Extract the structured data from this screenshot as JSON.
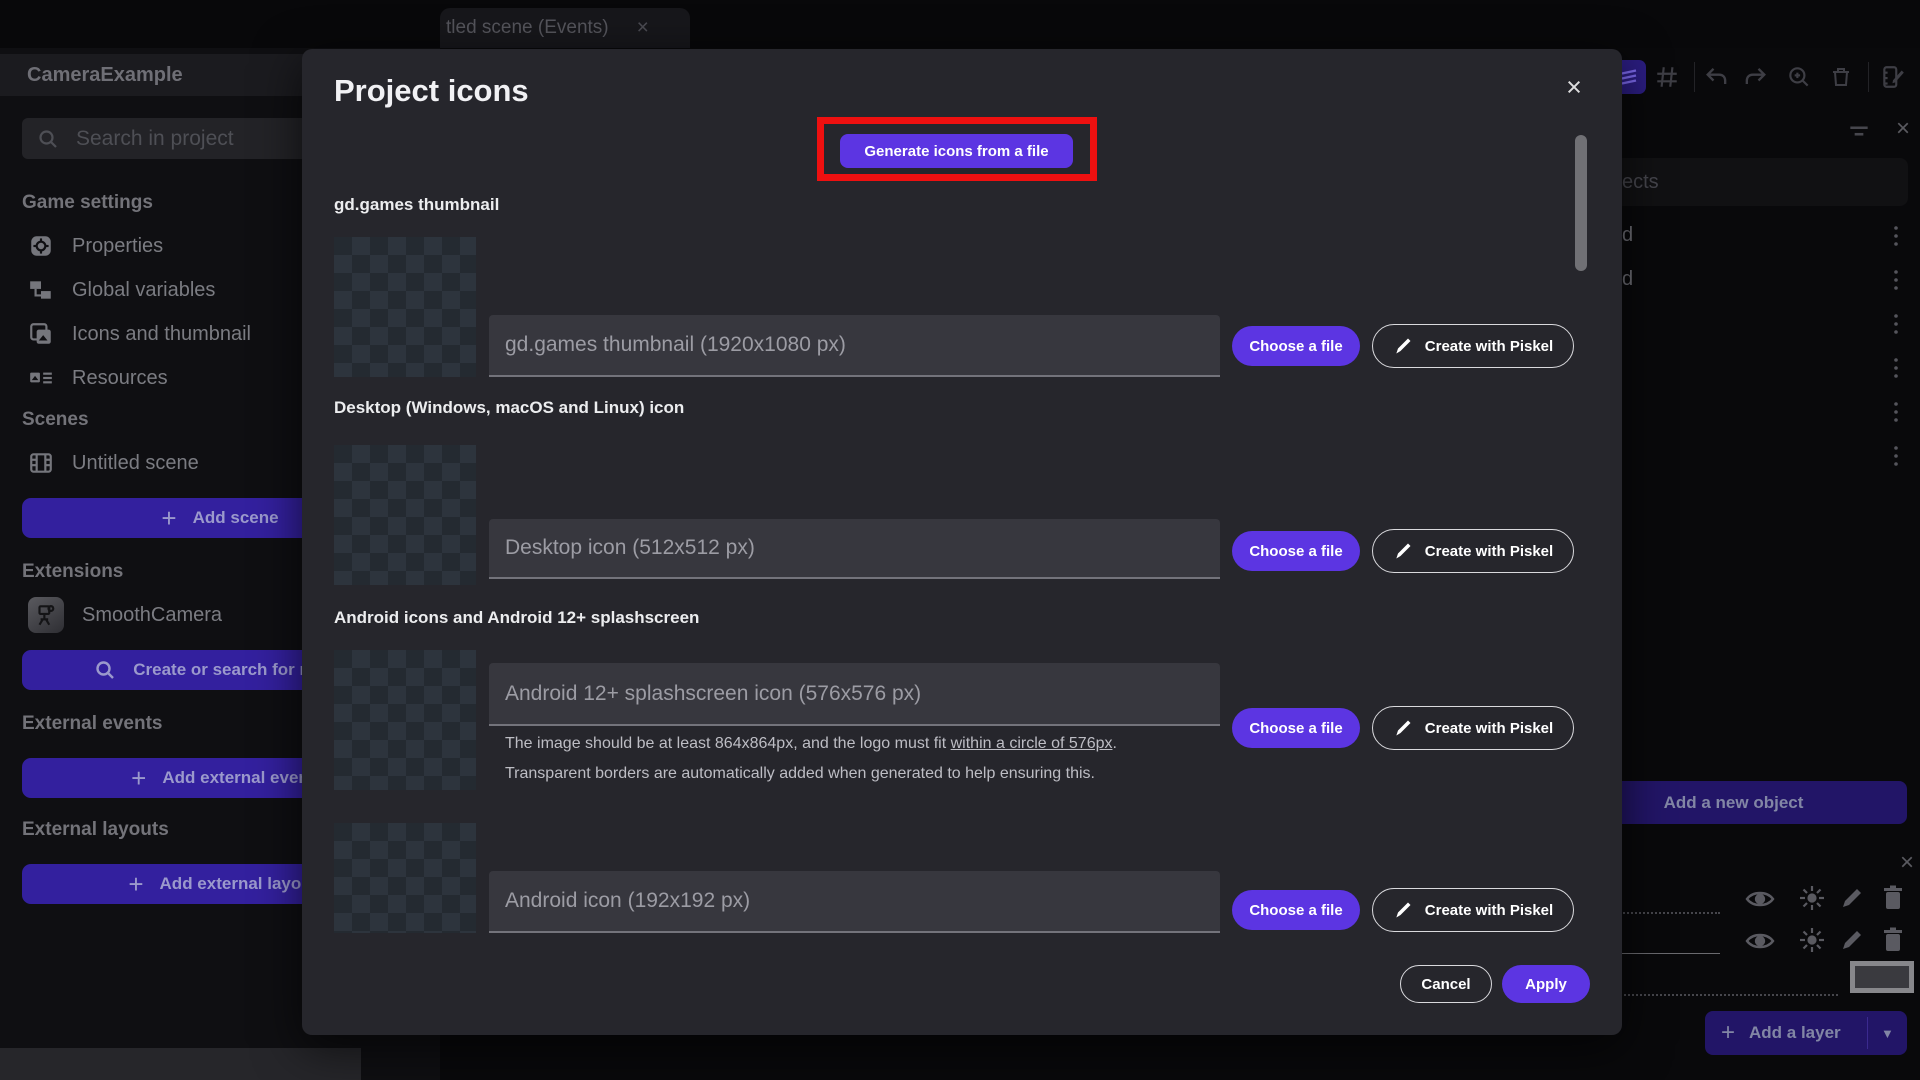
{
  "window": {
    "tab": {
      "label": "tled scene (Events)"
    }
  },
  "icons": {
    "close": "×",
    "plus": "+",
    "caret_down": "▼"
  },
  "sidebar": {
    "project_title": "CameraExample",
    "search_placeholder": "Search in project",
    "game_settings": {
      "label": "Game settings",
      "items": [
        {
          "label": "Properties"
        },
        {
          "label": "Global variables"
        },
        {
          "label": "Icons and thumbnail"
        },
        {
          "label": "Resources"
        }
      ]
    },
    "scenes": {
      "label": "Scenes",
      "items": [
        {
          "label": "Untitled scene"
        }
      ],
      "add_button": "Add scene"
    },
    "extensions": {
      "label": "Extensions",
      "items": [
        {
          "label": "SmoothCamera"
        }
      ],
      "search_button": "Create or search for new e"
    },
    "external_events": {
      "label": "External events",
      "add_button": "Add external even"
    },
    "external_layouts": {
      "label": "External layouts",
      "add_button": "Add external layou"
    }
  },
  "right_panel": {
    "search_fragment": "ects",
    "object_rows": [
      {
        "fragment": "d"
      },
      {
        "fragment": "d"
      },
      {
        "fragment": ""
      },
      {
        "fragment": ""
      },
      {
        "fragment": ""
      },
      {
        "fragment": ""
      }
    ],
    "add_new_object": "Add a new object",
    "add_a_layer": "Add a layer"
  },
  "modal": {
    "title": "Project icons",
    "generate_button": "Generate icons from a file",
    "choose_file": "Choose a file",
    "create_with_piskel": "Create with Piskel",
    "sections": [
      {
        "heading": "gd.games thumbnail",
        "placeholder": "gd.games thumbnail (1920x1080 px)"
      },
      {
        "heading": "Desktop (Windows, macOS and Linux) icon",
        "placeholder": "Desktop icon (512x512 px)"
      },
      {
        "heading": "Android icons and Android 12+ splashscreen",
        "placeholder": "Android 12+ splashscreen icon (576x576 px)",
        "help_line1_pre": "The image should be at least 864x864px, and the logo must fit ",
        "help_line1_link": "within a circle of 576px",
        "help_line1_post": ".",
        "help_line2": "Transparent borders are automatically added when generated to help ensuring this."
      },
      {
        "heading": "",
        "placeholder": "Android icon (192x192 px)"
      }
    ],
    "cancel": "Cancel",
    "apply": "Apply"
  },
  "colors": {
    "accent_purple": "#5c35e2",
    "dim_purple": "#33209e",
    "highlight_red": "#ee1010",
    "modal_bg": "#26262c"
  }
}
